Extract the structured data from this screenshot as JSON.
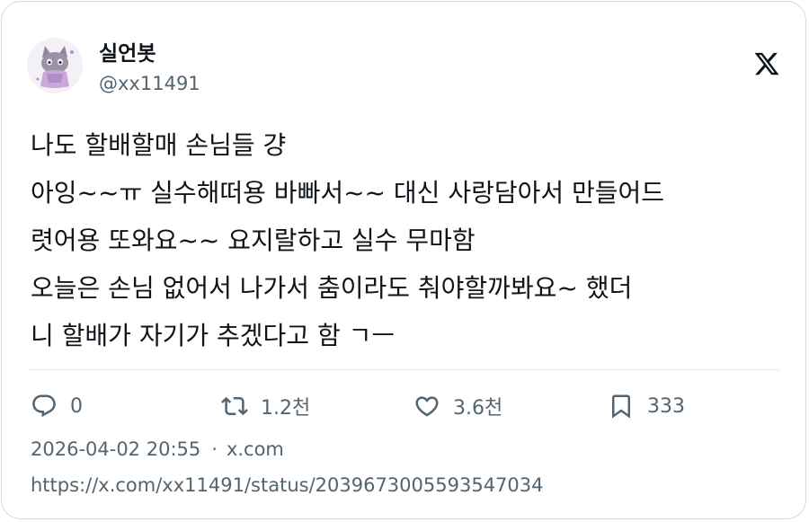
{
  "author": {
    "display_name": "실언봇",
    "handle": "@xx11491"
  },
  "brand": {
    "logo_icon": "x-logo-icon"
  },
  "tweet": {
    "lines": [
      "나도 할배할매 손님들 걍",
      "아잉~~ㅠ 실수해떠용 바빠서~~ 대신 사랑담아서 만들어드",
      "렷어용 또와요~~ 요지랄하고 실수 무마함",
      "오늘은 손님 없어서 나가서 춤이라도 춰야할까봐요~ 했더",
      "니 할배가 자기가 추겠다고 함 ㄱㅡ"
    ]
  },
  "actions": {
    "reply": {
      "icon": "reply-icon",
      "count": "0"
    },
    "retweet": {
      "icon": "retweet-icon",
      "count": "1.2천"
    },
    "like": {
      "icon": "heart-icon",
      "count": "3.6천"
    },
    "bookmark": {
      "icon": "bookmark-icon",
      "count": "333"
    }
  },
  "meta": {
    "timestamp": "2026-04-02 20:55",
    "separator": "·",
    "source": "x.com"
  },
  "url": "https://x.com/xx11491/status/2039673005593547034",
  "colors": {
    "text_primary": "#0f1419",
    "text_secondary": "#536471",
    "border": "#cfd9de",
    "divider": "#e7eaed"
  }
}
